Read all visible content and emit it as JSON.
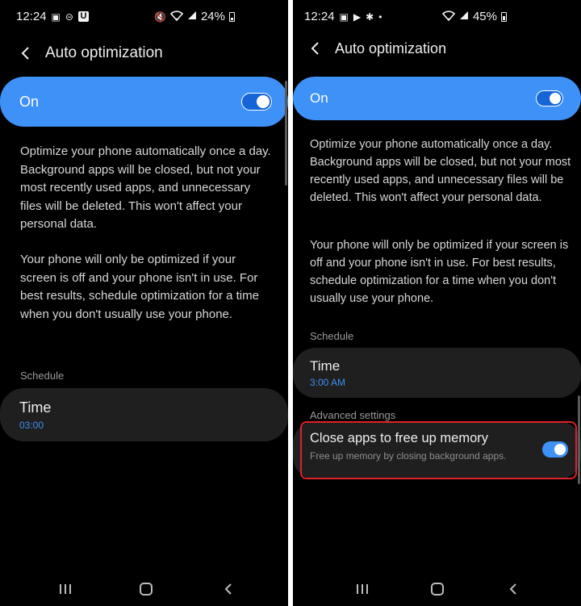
{
  "left": {
    "status": {
      "time": "12:24",
      "battery": "24%",
      "left_icons": [
        "image-icon",
        "do-not-disturb-icon",
        "u-app-icon"
      ],
      "right_icons": [
        "mute-icon",
        "wifi-icon",
        "signal-icon",
        "battery-icon"
      ]
    },
    "header": {
      "title": "Auto optimization"
    },
    "master": {
      "label": "On",
      "state": "on"
    },
    "desc1": "Optimize your phone automatically once a day. Background apps will be closed, but not your most recently used apps, and unnecessary files will be deleted. This won't affect your personal data.",
    "desc2": "Your phone will only be optimized if your screen is off and your phone isn't in use. For best results, schedule optimization for a time when you don't usually use your phone.",
    "schedule_label": "Schedule",
    "time_card": {
      "title": "Time",
      "value": "03:00"
    }
  },
  "right": {
    "status": {
      "time": "12:24",
      "battery": "45%",
      "left_icons": [
        "image-icon",
        "play-store-icon",
        "pinwheel-icon",
        "dot-icon"
      ],
      "right_icons": [
        "wifi-icon",
        "signal-icon",
        "battery-icon"
      ]
    },
    "header": {
      "title": "Auto optimization"
    },
    "master": {
      "label": "On",
      "state": "on"
    },
    "desc1": "Optimize your phone automatically once a day. Background apps will be closed, but not your most recently used apps, and unnecessary files will be deleted. This won't affect your personal data.",
    "desc2": "Your phone will only be optimized if your screen is off and your phone isn't in use. For best results, schedule optimization for a time when you don't usually use your phone.",
    "schedule_label": "Schedule",
    "time_card": {
      "title": "Time",
      "value": "3:00 AM"
    },
    "advanced_label": "Advanced settings",
    "memory": {
      "title": "Close apps to free up memory",
      "subtitle": "Free up memory by closing background apps.",
      "state": "on"
    }
  },
  "colors": {
    "accent": "#3e91f7",
    "background": "#000000",
    "card": "#1f1f1f",
    "highlight": "#e0202a",
    "value_text": "#3e8ef0"
  }
}
